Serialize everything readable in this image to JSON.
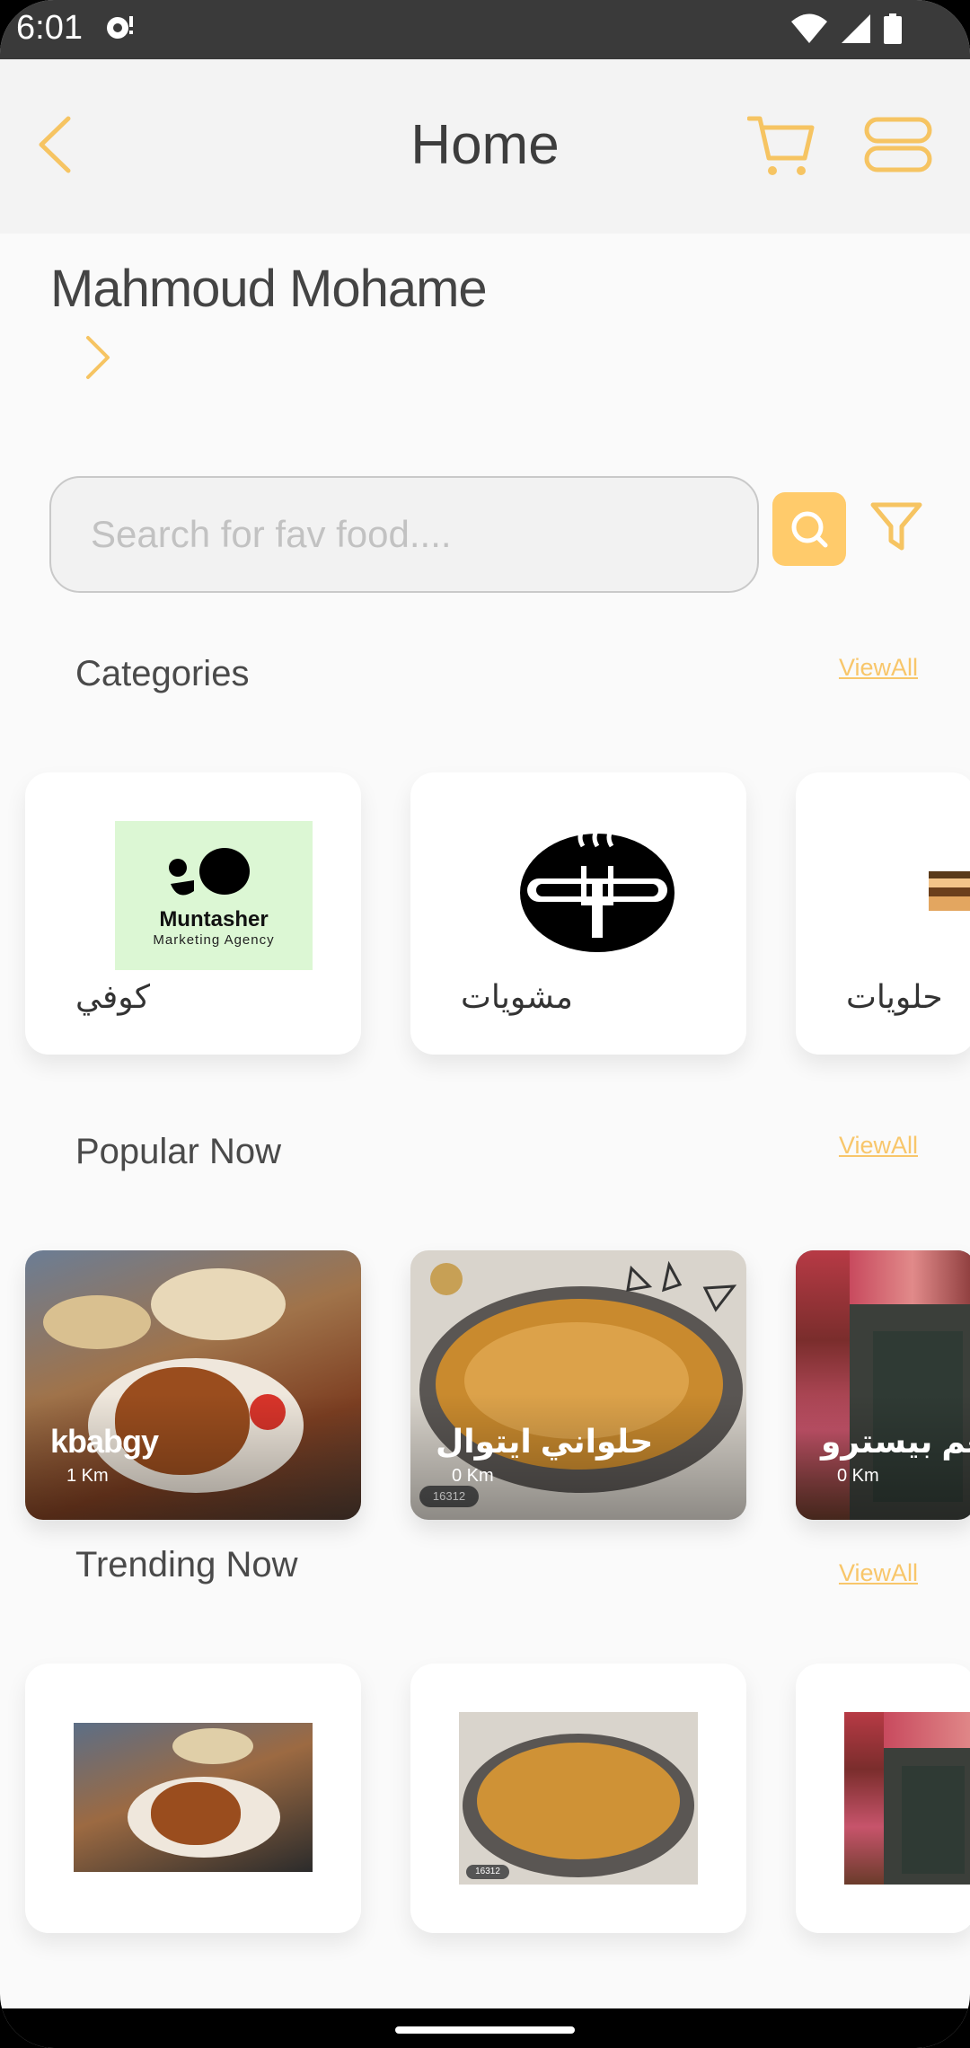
{
  "status_bar": {
    "time": "6:01"
  },
  "app_bar": {
    "title": "Home"
  },
  "user": {
    "name": "Mahmoud Mohame"
  },
  "search": {
    "placeholder": "Search for fav food...."
  },
  "sections": {
    "categories": {
      "title": "Categories",
      "view_all": "ViewAll"
    },
    "popular": {
      "title": "Popular Now",
      "view_all": "ViewAll"
    },
    "trending": {
      "title": "Trending Now",
      "view_all": "ViewAll"
    }
  },
  "categories": [
    {
      "label": "كوفي",
      "logo_line1": "Muntasher",
      "logo_line2": "Marketing Agency"
    },
    {
      "label": "مشويات"
    },
    {
      "label": "حلويات"
    }
  ],
  "popular": [
    {
      "name": "kbabgy",
      "distance": "1 Km"
    },
    {
      "name": "حلواني ايتوال",
      "distance": "0 Km",
      "badge": "16312"
    },
    {
      "name": "مطعم بيسترو",
      "distance": "0 Km"
    }
  ],
  "trending": [
    {
      "item": "grilled chicken"
    },
    {
      "item": "kunafa",
      "badge": "16312"
    },
    {
      "item": "bistro storefront"
    }
  ],
  "colors": {
    "accent": "#ffcb6b",
    "view_all": "#f8c66a",
    "icon": "#f6c462"
  }
}
